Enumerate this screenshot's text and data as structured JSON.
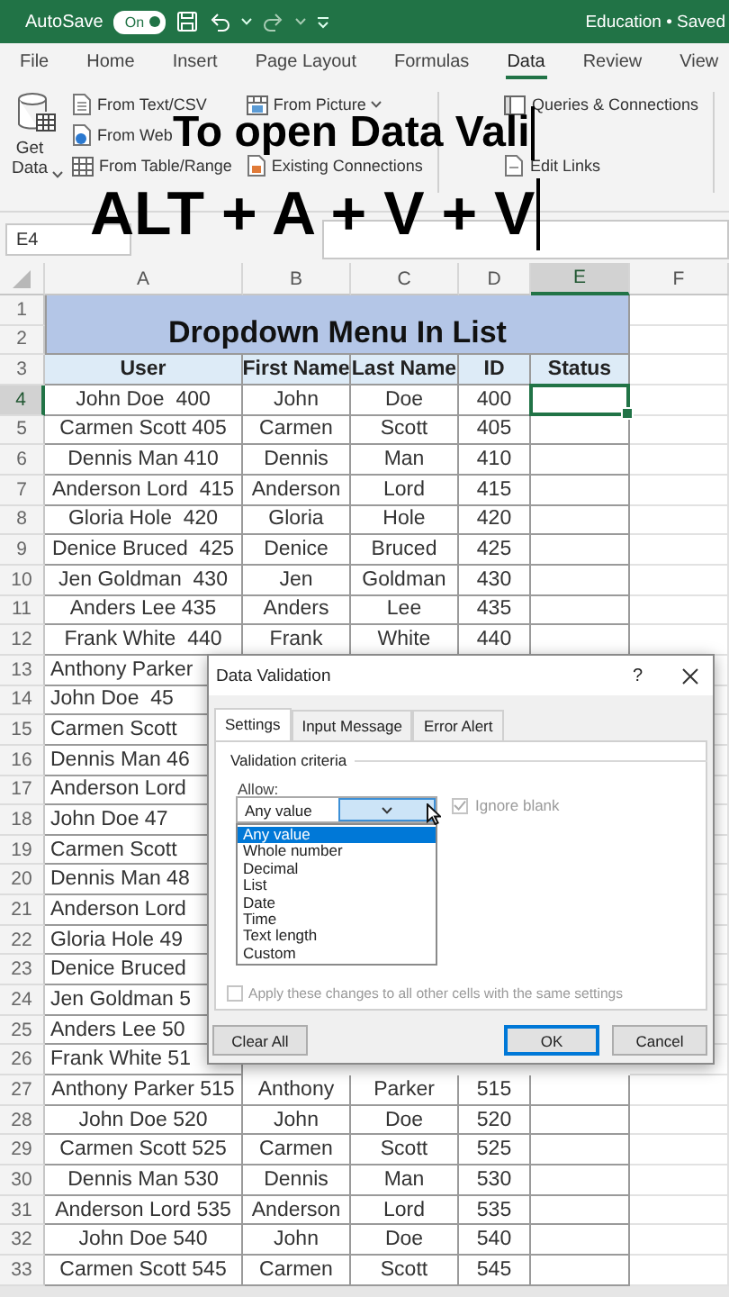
{
  "title_bar": {
    "autosave": {
      "label": "AutoSave",
      "state": "On",
      "on": true
    },
    "document": "Education • Saved"
  },
  "ribbon_tabs": [
    {
      "label": "File",
      "selected": false
    },
    {
      "label": "Home",
      "selected": false
    },
    {
      "label": "Insert",
      "selected": false
    },
    {
      "label": "Page Layout",
      "selected": false
    },
    {
      "label": "Formulas",
      "selected": false
    },
    {
      "label": "Data",
      "selected": true
    },
    {
      "label": "Review",
      "selected": false
    },
    {
      "label": "View",
      "selected": false
    }
  ],
  "ribbon": {
    "get_data": "Get Data",
    "from_text": "From Text/CSV",
    "from_web": "From Web",
    "from_table": "From Table/Range",
    "from_picture": "From Picture",
    "existing_connections": "Existing Connections",
    "queries_connections": "Queries & Connections",
    "edit_links": "Edit Links"
  },
  "caption": {
    "line_1": "To open Data Vali",
    "line_2": "ALT + A + V + V"
  },
  "name_box": "E4",
  "sheet": {
    "title": "Dropdown Menu In List",
    "columns": [
      {
        "label": "A",
        "selected": false
      },
      {
        "label": "B",
        "selected": false
      },
      {
        "label": "C",
        "selected": false
      },
      {
        "label": "D",
        "selected": false
      },
      {
        "label": "E",
        "selected": true
      },
      {
        "label": "F",
        "selected": false
      }
    ],
    "rows": [
      {
        "number": "1",
        "selected": false,
        "kind": "title"
      },
      {
        "number": "2",
        "selected": false,
        "kind": "title"
      },
      {
        "number": "3",
        "selected": false,
        "kind": "header",
        "cells": [
          "User",
          "First Name",
          "Last Name",
          "ID",
          "Status"
        ]
      },
      {
        "number": "4",
        "selected": true,
        "kind": "data",
        "cells": [
          "John Doe  400",
          "John",
          "Doe",
          "400"
        ]
      },
      {
        "number": "5",
        "selected": false,
        "kind": "data",
        "cells": [
          "Carmen Scott 405",
          "Carmen",
          "Scott",
          "405"
        ]
      },
      {
        "number": "6",
        "selected": false,
        "kind": "data",
        "cells": [
          "Dennis Man 410",
          "Dennis",
          "Man",
          "410"
        ]
      },
      {
        "number": "7",
        "selected": false,
        "kind": "data",
        "cells": [
          "Anderson Lord  415",
          "Anderson",
          "Lord",
          "415"
        ]
      },
      {
        "number": "8",
        "selected": false,
        "kind": "data",
        "cells": [
          "Gloria Hole  420",
          "Gloria",
          "Hole",
          "420"
        ]
      },
      {
        "number": "9",
        "selected": false,
        "kind": "data",
        "cells": [
          "Denice Bruced  425",
          "Denice",
          "Bruced",
          "425"
        ]
      },
      {
        "number": "10",
        "selected": false,
        "kind": "data",
        "cells": [
          "Jen Goldman  430",
          "Jen",
          "Goldman",
          "430"
        ]
      },
      {
        "number": "11",
        "selected": false,
        "kind": "data",
        "cells": [
          "Anders Lee 435",
          "Anders",
          "Lee",
          "435"
        ]
      },
      {
        "number": "12",
        "selected": false,
        "kind": "data",
        "cells": [
          "Frank White  440",
          "Frank",
          "White",
          "440"
        ]
      },
      {
        "number": "13",
        "selected": false,
        "kind": "data",
        "cells": [
          "Anthony Parker"
        ]
      },
      {
        "number": "14",
        "selected": false,
        "kind": "data",
        "cells": [
          "John Doe  45"
        ]
      },
      {
        "number": "15",
        "selected": false,
        "kind": "data",
        "cells": [
          "Carmen Scott"
        ]
      },
      {
        "number": "16",
        "selected": false,
        "kind": "data",
        "cells": [
          "Dennis Man 46"
        ]
      },
      {
        "number": "17",
        "selected": false,
        "kind": "data",
        "cells": [
          "Anderson Lord"
        ]
      },
      {
        "number": "18",
        "selected": false,
        "kind": "data",
        "cells": [
          "John Doe 47"
        ]
      },
      {
        "number": "19",
        "selected": false,
        "kind": "data",
        "cells": [
          "Carmen Scott"
        ]
      },
      {
        "number": "20",
        "selected": false,
        "kind": "data",
        "cells": [
          "Dennis Man 48"
        ]
      },
      {
        "number": "21",
        "selected": false,
        "kind": "data",
        "cells": [
          "Anderson Lord"
        ]
      },
      {
        "number": "22",
        "selected": false,
        "kind": "data",
        "cells": [
          "Gloria Hole 49"
        ]
      },
      {
        "number": "23",
        "selected": false,
        "kind": "data",
        "cells": [
          "Denice Bruced"
        ]
      },
      {
        "number": "24",
        "selected": false,
        "kind": "data",
        "cells": [
          "Jen Goldman 5"
        ]
      },
      {
        "number": "25",
        "selected": false,
        "kind": "data",
        "cells": [
          "Anders Lee 50"
        ]
      },
      {
        "number": "26",
        "selected": false,
        "kind": "data",
        "cells": [
          "Frank White 51"
        ]
      },
      {
        "number": "27",
        "selected": false,
        "kind": "data",
        "cells": [
          "Anthony Parker 515",
          "Anthony",
          "Parker",
          "515"
        ]
      },
      {
        "number": "28",
        "selected": false,
        "kind": "data",
        "cells": [
          "John Doe 520",
          "John",
          "Doe",
          "520"
        ]
      },
      {
        "number": "29",
        "selected": false,
        "kind": "data",
        "cells": [
          "Carmen Scott 525",
          "Carmen",
          "Scott",
          "525"
        ]
      },
      {
        "number": "30",
        "selected": false,
        "kind": "data",
        "cells": [
          "Dennis Man 530",
          "Dennis",
          "Man",
          "530"
        ]
      },
      {
        "number": "31",
        "selected": false,
        "kind": "data",
        "cells": [
          "Anderson Lord 535",
          "Anderson",
          "Lord",
          "535"
        ]
      },
      {
        "number": "32",
        "selected": false,
        "kind": "data",
        "cells": [
          "John Doe 540",
          "John",
          "Doe",
          "540"
        ]
      },
      {
        "number": "33",
        "selected": false,
        "kind": "data",
        "cells": [
          "Carmen Scott 545",
          "Carmen",
          "Scott",
          "545"
        ]
      }
    ]
  },
  "dialog": {
    "title": "Data Validation",
    "help": "?",
    "tabs": [
      {
        "label": "Settings",
        "selected": true
      },
      {
        "label": "Input Message",
        "selected": false
      },
      {
        "label": "Error Alert",
        "selected": false
      }
    ],
    "section": "Validation criteria",
    "allow_label": "Allow:",
    "allow_value": "Any value",
    "ignore_blank": {
      "label": "Ignore blank",
      "checked": true,
      "disabled": true
    },
    "options": [
      {
        "label": "Any value",
        "selected": true
      },
      {
        "label": "Whole number",
        "selected": false
      },
      {
        "label": "Decimal",
        "selected": false
      },
      {
        "label": "List",
        "selected": false
      },
      {
        "label": "Date",
        "selected": false
      },
      {
        "label": "Time",
        "selected": false
      },
      {
        "label": "Text length",
        "selected": false
      },
      {
        "label": "Custom",
        "selected": false
      }
    ],
    "apply_all": {
      "label": "Apply these changes to all other cells with the same settings",
      "checked": false,
      "disabled": true
    },
    "buttons": [
      {
        "label": "Clear All",
        "default": false
      },
      {
        "label": "OK",
        "default": true
      },
      {
        "label": "Cancel",
        "default": false
      }
    ]
  }
}
